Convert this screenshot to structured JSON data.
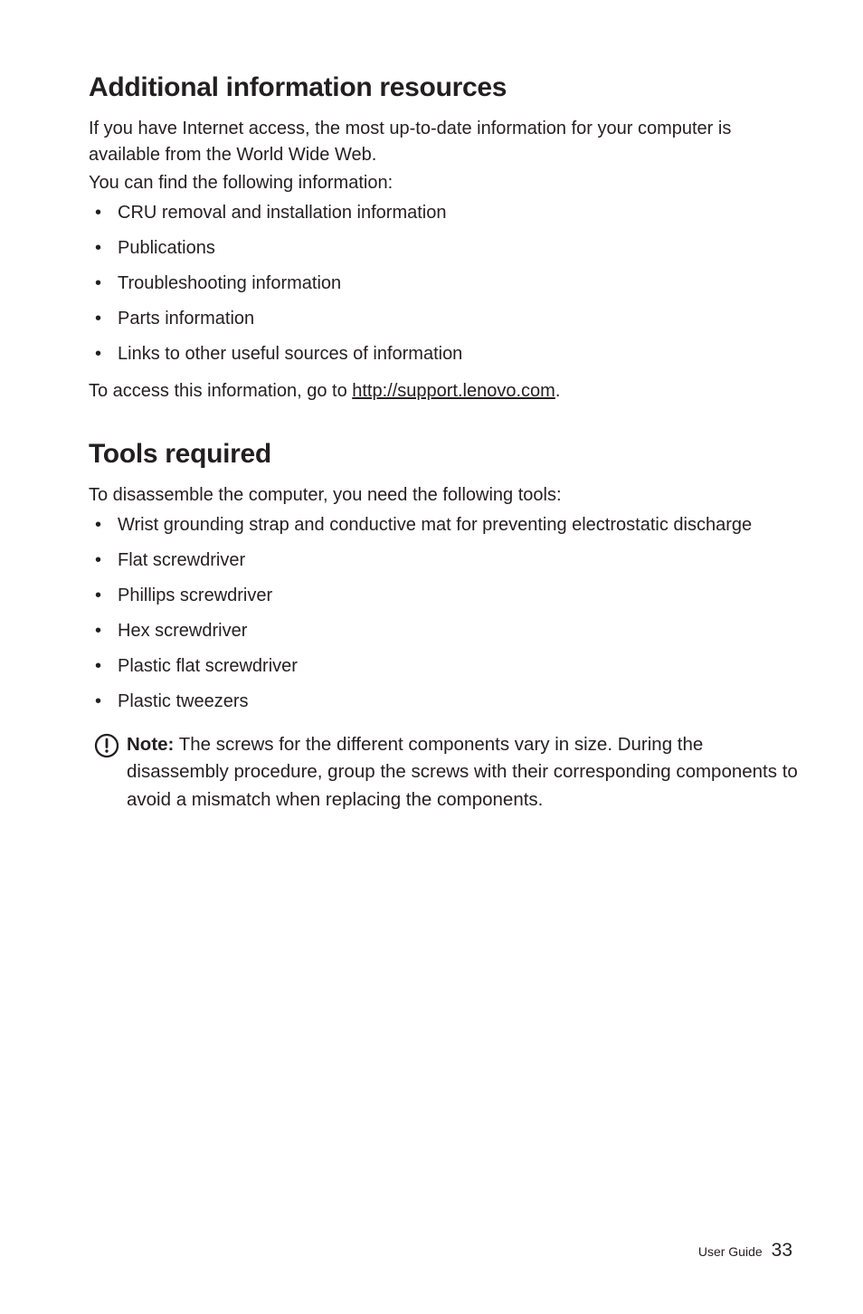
{
  "section1": {
    "heading": "Additional information resources",
    "p1": "If you have Internet access, the most up-to-date information for your computer is available from the World Wide Web.",
    "p2": "You can find the following information:",
    "items": [
      "CRU removal and installation information",
      "Publications",
      "Troubleshooting information",
      "Parts information",
      "Links to other useful sources of information"
    ],
    "access_prefix": "To access this information, go to ",
    "access_link": "http://support.lenovo.com",
    "access_suffix": "."
  },
  "section2": {
    "heading": "Tools required",
    "p1": "To disassemble the computer, you need the following tools:",
    "items": [
      "Wrist grounding strap and conductive mat for preventing electrostatic discharge",
      "Flat screwdriver",
      "Phillips screwdriver",
      "Hex screwdriver",
      "Plastic flat screwdriver",
      "Plastic tweezers"
    ],
    "note_label": "Note:",
    "note_text": " The screws for the different components vary in size. During the disassembly procedure, group the screws with their corresponding components to avoid a mismatch when replacing the components."
  },
  "footer": {
    "label": "User Guide",
    "page": "33"
  }
}
